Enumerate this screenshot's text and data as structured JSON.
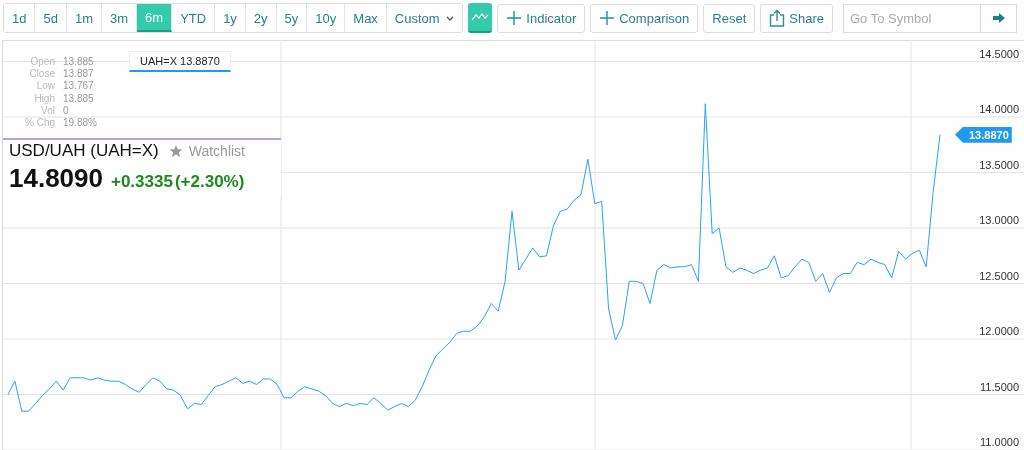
{
  "toolbar": {
    "ranges": [
      {
        "label": "1d",
        "selected": false
      },
      {
        "label": "5d",
        "selected": false
      },
      {
        "label": "1m",
        "selected": false
      },
      {
        "label": "3m",
        "selected": false
      },
      {
        "label": "6m",
        "selected": true
      },
      {
        "label": "YTD",
        "selected": false
      },
      {
        "label": "1y",
        "selected": false
      },
      {
        "label": "2y",
        "selected": false
      },
      {
        "label": "5y",
        "selected": false
      },
      {
        "label": "10y",
        "selected": false
      },
      {
        "label": "Max",
        "selected": false
      }
    ],
    "custom": {
      "label": "Custom"
    },
    "chart_type_button": {
      "selected": true
    },
    "buttons": [
      {
        "kind": "indicator",
        "label": "Indicator"
      },
      {
        "kind": "comparison",
        "label": "Comparison"
      },
      {
        "kind": "reset",
        "label": "Reset"
      },
      {
        "kind": "share",
        "label": "Share"
      }
    ],
    "symbol_search": {
      "placeholder": "Go To Symbol"
    }
  },
  "ohlc": [
    {
      "label": "Open",
      "value": "13.885"
    },
    {
      "label": "Close",
      "value": "13.887"
    },
    {
      "label": "Low",
      "value": "13.767"
    },
    {
      "label": "High",
      "value": "13.885"
    },
    {
      "label": "Vol",
      "value": "0"
    },
    {
      "label": "% Chg",
      "value": "19.88%"
    }
  ],
  "crosshair_label": "UAH=X 13.8870",
  "quote": {
    "title": "USD/UAH (UAH=X)",
    "watchlist": "Watchlist",
    "price": "14.8090",
    "change": "+0.3335",
    "change_percent": "(+2.30%)"
  },
  "chart": {
    "last_price_tag": "13.8870",
    "chart_data": {
      "type": "line",
      "grid": true,
      "ylim": [
        11,
        14.5
      ],
      "yticks": [
        {
          "value": 11,
          "label": "11.0000"
        },
        {
          "value": 11.5,
          "label": "11.5000"
        },
        {
          "value": 12,
          "label": "12.0000"
        },
        {
          "value": 12.5,
          "label": "12.5000"
        },
        {
          "value": 13,
          "label": "13.0000"
        },
        {
          "value": 13.5,
          "label": "13.5000"
        },
        {
          "value": 14,
          "label": "14.0000"
        },
        {
          "value": 14.5,
          "label": "14.5000"
        }
      ],
      "series": [
        {
          "color": "#29a3f0",
          "values": [
            11.5,
            11.62,
            11.35,
            11.35,
            11.42,
            11.49,
            11.55,
            11.62,
            11.54,
            11.65,
            11.65,
            11.65,
            11.63,
            11.65,
            11.63,
            11.62,
            11.62,
            11.59,
            11.55,
            11.52,
            11.59,
            11.65,
            11.62,
            11.55,
            11.54,
            11.49,
            11.37,
            11.42,
            11.41,
            11.49,
            11.57,
            11.59,
            11.62,
            11.65,
            11.6,
            11.62,
            11.59,
            11.64,
            11.64,
            11.59,
            11.47,
            11.47,
            11.53,
            11.57,
            11.55,
            11.53,
            11.49,
            11.42,
            11.39,
            11.42,
            11.4,
            11.42,
            11.41,
            11.47,
            11.42,
            11.36,
            11.39,
            11.42,
            11.39,
            11.45,
            11.57,
            11.72,
            11.85,
            11.91,
            11.97,
            12.05,
            12.07,
            12.07,
            12.12,
            12.2,
            12.32,
            12.25,
            12.52,
            13.15,
            12.62,
            12.72,
            12.82,
            12.74,
            12.75,
            13.02,
            13.15,
            13.17,
            13.25,
            13.3,
            13.62,
            13.22,
            13.24,
            12.27,
            11.99,
            12.12,
            12.52,
            12.52,
            12.5,
            12.32,
            12.62,
            12.67,
            12.64,
            12.65,
            12.65,
            12.67,
            12.52,
            14.12,
            12.95,
            13,
            12.65,
            12.6,
            12.64,
            12.62,
            12.59,
            12.62,
            12.64,
            12.75,
            12.55,
            12.57,
            12.65,
            12.72,
            12.69,
            12.52,
            12.59,
            12.42,
            12.55,
            12.59,
            12.59,
            12.69,
            12.67,
            12.72,
            12.69,
            12.67,
            12.55,
            12.79,
            12.72,
            12.77,
            12.8,
            12.65,
            13.32,
            13.84
          ]
        }
      ]
    }
  }
}
